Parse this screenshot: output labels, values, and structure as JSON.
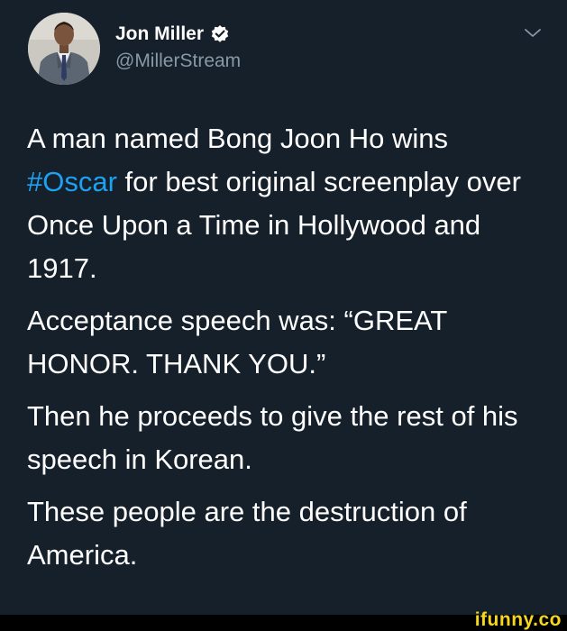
{
  "author": {
    "display_name": "Jon Miller",
    "handle": "@MillerStream",
    "verified_icon": "verified-badge-icon",
    "menu_icon": "chevron-down-icon"
  },
  "tweet": {
    "p1_pre": "A man named Bong Joon Ho wins ",
    "p1_hashtag": "#Oscar",
    "p1_post": " for best original screenplay over Once Upon a Time in Hollywood and 1917.",
    "p2": "Acceptance speech was: “GREAT HONOR. THANK YOU.”",
    "p3": "Then he proceeds to give the rest of his speech in Korean.",
    "p4": "These people are the destruction of America."
  },
  "watermark": {
    "text": "ifunny.co"
  },
  "colors": {
    "background": "#15202b",
    "text": "#ffffff",
    "secondary_text": "#8899a6",
    "link": "#1da1f2",
    "watermark": "#f7d61e"
  }
}
